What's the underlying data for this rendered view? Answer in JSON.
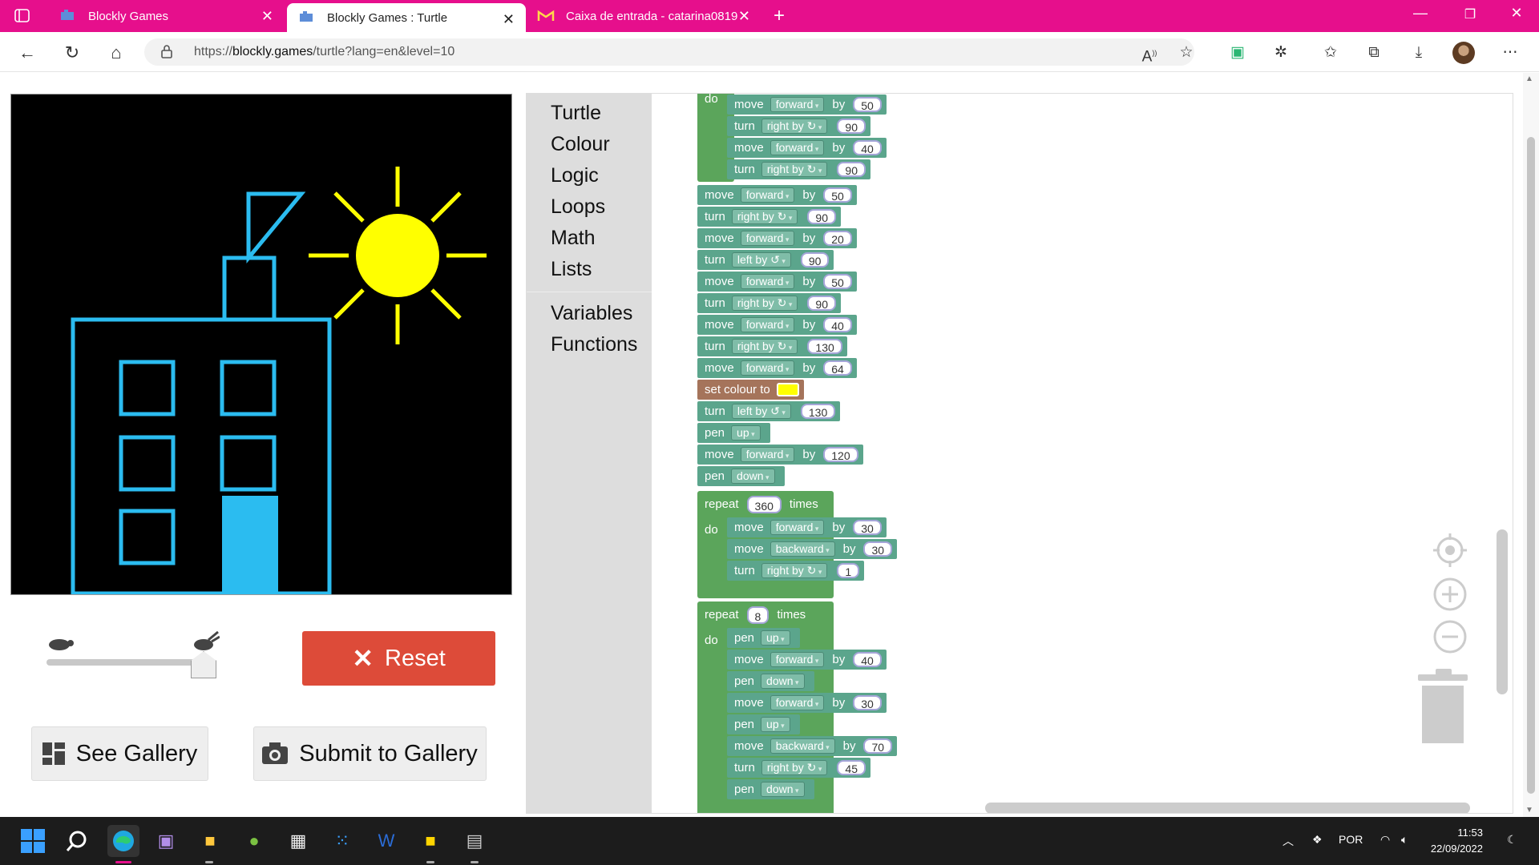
{
  "browser": {
    "tabs": [
      {
        "title": "Blockly Games",
        "active": false
      },
      {
        "title": "Blockly Games : Turtle",
        "active": true
      },
      {
        "title": "Caixa de entrada - catarina0819",
        "active": false
      }
    ],
    "url_prefix": "https://",
    "url_host": "blockly.games",
    "url_path": "/turtle?lang=en&level=10"
  },
  "controls": {
    "reset_label": "Reset",
    "gallery_label": "See Gallery",
    "submit_label": "Submit to Gallery"
  },
  "toolbox": {
    "categories": [
      "Turtle",
      "Colour",
      "Logic",
      "Loops",
      "Math",
      "Lists",
      "Variables",
      "Functions"
    ]
  },
  "blocks": {
    "do": "do",
    "move": "move",
    "turn": "turn",
    "by": "by",
    "pen": "pen",
    "repeat": "repeat",
    "times": "times",
    "set_colour": "set colour to",
    "forward": "forward",
    "backward": "backward",
    "right_by": "right by ↻",
    "left_by": "left by ↺",
    "up": "up",
    "down": "down",
    "top_loop_body": [
      {
        "cmd": "move",
        "dir": "forward",
        "val": "50"
      },
      {
        "cmd": "turn",
        "dir": "right by ↻",
        "val": "90"
      },
      {
        "cmd": "move",
        "dir": "forward",
        "val": "40"
      },
      {
        "cmd": "turn",
        "dir": "right by ↻",
        "val": "90"
      }
    ],
    "sequence": [
      {
        "cmd": "move",
        "dir": "forward",
        "val": "50"
      },
      {
        "cmd": "turn",
        "dir": "right by ↻",
        "val": "90"
      },
      {
        "cmd": "move",
        "dir": "forward",
        "val": "20"
      },
      {
        "cmd": "turn",
        "dir": "left by ↺",
        "val": "90"
      },
      {
        "cmd": "move",
        "dir": "forward",
        "val": "50"
      },
      {
        "cmd": "turn",
        "dir": "right by ↻",
        "val": "90"
      },
      {
        "cmd": "move",
        "dir": "forward",
        "val": "40"
      },
      {
        "cmd": "turn",
        "dir": "right by ↻",
        "val": "130"
      },
      {
        "cmd": "move",
        "dir": "forward",
        "val": "64"
      }
    ],
    "colour_value": "#ffff00",
    "sequence2": [
      {
        "cmd": "turn",
        "dir": "left by ↺",
        "val": "130"
      },
      {
        "cmd": "pen",
        "dir": "up",
        "val": ""
      },
      {
        "cmd": "move",
        "dir": "forward",
        "val": "120"
      },
      {
        "cmd": "pen",
        "dir": "down",
        "val": ""
      }
    ],
    "repeat1": {
      "count": "360",
      "body": [
        {
          "cmd": "move",
          "dir": "forward",
          "val": "30"
        },
        {
          "cmd": "move",
          "dir": "backward",
          "val": "30"
        },
        {
          "cmd": "turn",
          "dir": "right by ↻",
          "val": "1"
        }
      ]
    },
    "repeat2": {
      "count": "8",
      "body": [
        {
          "cmd": "pen",
          "dir": "up",
          "val": ""
        },
        {
          "cmd": "move",
          "dir": "forward",
          "val": "40"
        },
        {
          "cmd": "pen",
          "dir": "down",
          "val": ""
        },
        {
          "cmd": "move",
          "dir": "forward",
          "val": "30"
        },
        {
          "cmd": "pen",
          "dir": "up",
          "val": ""
        },
        {
          "cmd": "move",
          "dir": "backward",
          "val": "70"
        },
        {
          "cmd": "turn",
          "dir": "right by ↻",
          "val": "45"
        },
        {
          "cmd": "pen",
          "dir": "down",
          "val": ""
        }
      ]
    }
  },
  "speed_level": 1.0,
  "drawing_colors": {
    "building": "#2bbcf0",
    "sun": "#ffff00",
    "background": "#000000"
  },
  "taskbar": {
    "language": "POR",
    "time": "11:53",
    "date": "22/09/2022"
  }
}
